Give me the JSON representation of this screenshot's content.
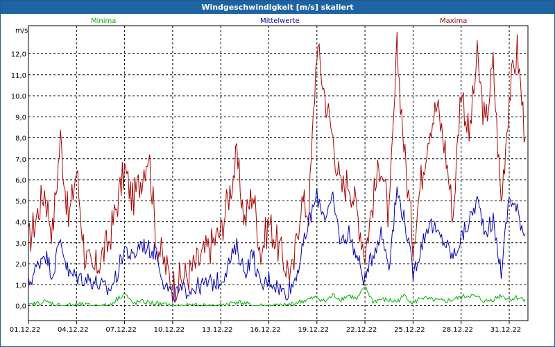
{
  "window": {
    "title": "Windgeschwindigkeit [m/s] skaliert"
  },
  "colors": {
    "title_bar": "#1e64a3",
    "minima": "#00b000",
    "mittelwerte": "#0000b4",
    "maxima": "#a80000",
    "grid": "#000000"
  },
  "legend": [
    {
      "label": "Minima",
      "color": "#00b000"
    },
    {
      "label": "Mittelwerte",
      "color": "#0000b4"
    },
    {
      "label": "Maxima",
      "color": "#a80000"
    }
  ],
  "chart_data": {
    "type": "line",
    "title": "Windgeschwindigkeit [m/s] skaliert",
    "ylabel": "m/s",
    "ylim": [
      -0.5,
      13.3
    ],
    "xlim": [
      "2022-12-01",
      "2023-01-02"
    ],
    "y_ticks": [
      "0,0",
      "1,0",
      "2,0",
      "3,0",
      "4,0",
      "5,0",
      "6,0",
      "7,0",
      "8,0",
      "9,0",
      "10,0",
      "11,0",
      "12,0"
    ],
    "x_ticks": [
      "01.12.22",
      "04.12.22",
      "07.12.22",
      "10.12.22",
      "13.12.22",
      "16.12.22",
      "19.12.22",
      "22.12.22",
      "25.12.22",
      "28.12.22",
      "31.12.22"
    ],
    "grid": true,
    "legend_position": "top",
    "series": [
      {
        "name": "Maxima",
        "color": "#a80000",
        "points": [
          [
            "01.12.22",
            3.0
          ],
          [
            "02.12.22",
            5.5
          ],
          [
            "02.12.22 12h",
            3.5
          ],
          [
            "03.12.22",
            8.0
          ],
          [
            "03.12.22 12h",
            4.0
          ],
          [
            "04.12.22",
            6.5
          ],
          [
            "04.12.22 12h",
            2.5
          ],
          [
            "05.12.22",
            1.5
          ],
          [
            "06.12.22",
            3.0
          ],
          [
            "07.12.22",
            6.5
          ],
          [
            "07.12.22 12h",
            5.0
          ],
          [
            "08.12.22",
            6.0
          ],
          [
            "08.12.22 12h",
            7.4
          ],
          [
            "09.12.22",
            3.0
          ],
          [
            "09.12.22 12h",
            2.0
          ],
          [
            "10.12.22",
            1.0
          ],
          [
            "11.12.22",
            1.5
          ],
          [
            "12.12.22",
            2.5
          ],
          [
            "13.12.22",
            3.5
          ],
          [
            "14.12.22",
            7.0
          ],
          [
            "14.12.22 12h",
            4.0
          ],
          [
            "15.12.22",
            5.5
          ],
          [
            "15.12.22 12h",
            2.5
          ],
          [
            "16.12.22",
            4.0
          ],
          [
            "17.12.22",
            2.0
          ],
          [
            "17.12.22 12h",
            1.5
          ],
          [
            "18.12.22",
            5.0
          ],
          [
            "18.12.22 12h",
            4.5
          ],
          [
            "19.12.22",
            12.4
          ],
          [
            "19.12.22 12h",
            10.0
          ],
          [
            "20.12.22",
            8.0
          ],
          [
            "20.12.22 12h",
            5.5
          ],
          [
            "21.12.22",
            6.0
          ],
          [
            "21.12.22 12h",
            4.5
          ],
          [
            "22.12.22",
            2.5
          ],
          [
            "22.12.22 12h",
            5.0
          ],
          [
            "23.12.22",
            7.0
          ],
          [
            "23.12.22 12h",
            4.0
          ],
          [
            "24.12.22",
            12.2
          ],
          [
            "24.12.22 12h",
            7.0
          ],
          [
            "25.12.22",
            3.0
          ],
          [
            "25.12.22 12h",
            6.0
          ],
          [
            "26.12.22",
            8.5
          ],
          [
            "26.12.22 12h",
            9.5
          ],
          [
            "27.12.22",
            7.5
          ],
          [
            "27.12.22 12h",
            4.3
          ],
          [
            "28.12.22",
            10.5
          ],
          [
            "28.12.22 12h",
            8.0
          ],
          [
            "29.12.22",
            11.8
          ],
          [
            "29.12.22 12h",
            8.5
          ],
          [
            "30.12.22",
            11.5
          ],
          [
            "30.12.22 12h",
            4.9
          ],
          [
            "31.12.22",
            10.0
          ],
          [
            "31.12.22 12h",
            12.2
          ],
          [
            "01.01.23",
            8.0
          ]
        ]
      },
      {
        "name": "Mittelwerte",
        "color": "#0000b4",
        "points": [
          [
            "01.12.22",
            1.0
          ],
          [
            "02.12.22",
            2.6
          ],
          [
            "02.12.22 12h",
            1.5
          ],
          [
            "03.12.22",
            3.2
          ],
          [
            "03.12.22 12h",
            1.5
          ],
          [
            "04.12.22",
            1.4
          ],
          [
            "05.12.22",
            1.2
          ],
          [
            "06.12.22",
            0.7
          ],
          [
            "06.12.22 12h",
            1.4
          ],
          [
            "07.12.22",
            2.8
          ],
          [
            "07.12.22 12h",
            2.2
          ],
          [
            "08.12.22",
            3.0
          ],
          [
            "08.12.22 12h",
            2.7
          ],
          [
            "09.12.22",
            2.5
          ],
          [
            "09.12.22 12h",
            1.0
          ],
          [
            "10.12.22",
            0.5
          ],
          [
            "11.12.22",
            0.8
          ],
          [
            "12.12.22",
            1.0
          ],
          [
            "13.12.22",
            1.2
          ],
          [
            "14.12.22",
            2.8
          ],
          [
            "14.12.22 12h",
            1.6
          ],
          [
            "15.12.22",
            2.5
          ],
          [
            "15.12.22 12h",
            0.8
          ],
          [
            "16.12.22",
            1.3
          ],
          [
            "17.12.22",
            0.6
          ],
          [
            "17.12.22 12h",
            1.0
          ],
          [
            "18.12.22",
            2.3
          ],
          [
            "18.12.22 12h",
            4.0
          ],
          [
            "19.12.22",
            5.2
          ],
          [
            "19.12.22 12h",
            4.3
          ],
          [
            "20.12.22",
            5.0
          ],
          [
            "20.12.22 12h",
            3.0
          ],
          [
            "21.12.22",
            3.5
          ],
          [
            "21.12.22 12h",
            2.3
          ],
          [
            "22.12.22",
            1.2
          ],
          [
            "22.12.22 12h",
            2.5
          ],
          [
            "23.12.22",
            3.5
          ],
          [
            "23.12.22 12h",
            2.0
          ],
          [
            "24.12.22",
            5.5
          ],
          [
            "24.12.22 12h",
            4.0
          ],
          [
            "25.12.22",
            1.5
          ],
          [
            "25.12.22 12h",
            2.8
          ],
          [
            "26.12.22",
            4.0
          ],
          [
            "26.12.22 12h",
            3.4
          ],
          [
            "27.12.22",
            3.0
          ],
          [
            "27.12.22 12h",
            2.3
          ],
          [
            "28.12.22",
            3.2
          ],
          [
            "28.12.22 12h",
            4.0
          ],
          [
            "29.12.22",
            5.0
          ],
          [
            "29.12.22 12h",
            3.6
          ],
          [
            "30.12.22",
            4.0
          ],
          [
            "30.12.22 12h",
            1.6
          ],
          [
            "31.12.22",
            5.2
          ],
          [
            "31.12.22 12h",
            4.5
          ],
          [
            "01.01.23",
            3.4
          ]
        ]
      },
      {
        "name": "Minima",
        "color": "#00b000",
        "points": [
          [
            "01.12.22",
            0.0
          ],
          [
            "02.12.22",
            0.2
          ],
          [
            "03.12.22",
            0.0
          ],
          [
            "04.12.22",
            0.05
          ],
          [
            "05.12.22",
            0.0
          ],
          [
            "06.12.22",
            0.0
          ],
          [
            "07.12.22",
            0.6
          ],
          [
            "07.12.22 12h",
            0.1
          ],
          [
            "08.12.22",
            0.2
          ],
          [
            "09.12.22",
            0.1
          ],
          [
            "10.12.22",
            0.0
          ],
          [
            "13.12.22",
            0.0
          ],
          [
            "14.12.22",
            0.2
          ],
          [
            "15.12.22",
            0.0
          ],
          [
            "16.12.22",
            0.0
          ],
          [
            "17.12.22",
            0.0
          ],
          [
            "18.12.22",
            0.2
          ],
          [
            "18.12.22 12h",
            0.3
          ],
          [
            "19.12.22",
            0.4
          ],
          [
            "19.12.22 12h",
            0.2
          ],
          [
            "20.12.22",
            0.5
          ],
          [
            "20.12.22 12h",
            0.3
          ],
          [
            "21.12.22",
            0.5
          ],
          [
            "21.12.22 12h",
            0.3
          ],
          [
            "22.12.22",
            0.9
          ],
          [
            "22.12.22 12h",
            0.2
          ],
          [
            "23.12.22",
            0.3
          ],
          [
            "24.12.22",
            0.2
          ],
          [
            "24.12.22 12h",
            0.5
          ],
          [
            "25.12.22",
            0.1
          ],
          [
            "25.12.22 12h",
            0.4
          ],
          [
            "26.12.22",
            0.3
          ],
          [
            "27.12.22",
            0.2
          ],
          [
            "27.12.22 12h",
            0.3
          ],
          [
            "28.12.22",
            0.4
          ],
          [
            "28.12.22 12h",
            0.5
          ],
          [
            "29.12.22",
            0.4
          ],
          [
            "29.12.22 12h",
            0.2
          ],
          [
            "30.12.22",
            0.3
          ],
          [
            "30.12.22 12h",
            0.5
          ],
          [
            "31.12.22",
            0.3
          ],
          [
            "31.12.22 12h",
            0.4
          ],
          [
            "01.01.23",
            0.3
          ]
        ]
      }
    ]
  }
}
